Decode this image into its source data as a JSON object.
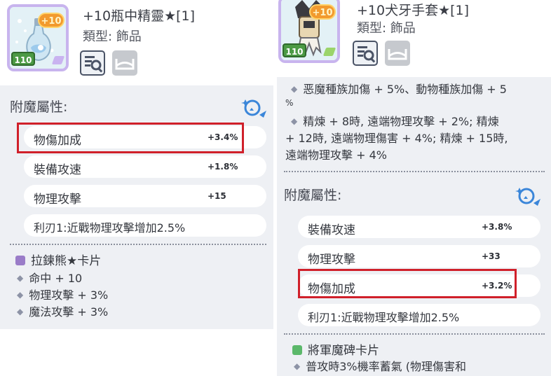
{
  "left_item": {
    "name": "+10瓶中精靈★[1]",
    "type_label": "類型: 飾品",
    "plus_badge": "+10",
    "level_badge": "110",
    "enchant_title": "附魔屬性:",
    "attributes": [
      {
        "name": "物傷加成",
        "value": "+3.4%"
      },
      {
        "name": "裝備攻速",
        "value": "+1.8%"
      },
      {
        "name": "物理攻擊",
        "value": "+15"
      }
    ],
    "special_attribute": "利刃1:近戰物理攻擊增加2.5%",
    "card": {
      "name": "拉鍊熊★卡片",
      "effects": [
        "命中 + 10",
        "物理攻擊 + 3%",
        "魔法攻擊 + 3%"
      ]
    }
  },
  "right_item": {
    "name": "+10犬牙手套★[1]",
    "type_label": "類型: 飾品",
    "plus_badge": "+10",
    "level_badge": "110",
    "refine_effects": [
      "恶魔種族加傷 + 5%、動物種族加傷 + 5",
      "%",
      "精煉 + 8時, 遠端物理攻擊 + 2%; 精煉",
      "+ 12時, 遠端物理傷害 + 4%; 精煉 + 15時,",
      "遠端物理攻擊 + 4%"
    ],
    "enchant_title": "附魔屬性:",
    "attributes": [
      {
        "name": "裝備攻速",
        "value": "+3.8%"
      },
      {
        "name": "物理攻擊",
        "value": "+33"
      },
      {
        "name": "物傷加成",
        "value": "+3.2%"
      }
    ],
    "special_attribute": "利刃1:近戰物理攻擊增加2.5%",
    "card": {
      "name": "將軍魔碑卡片",
      "effects": [
        "普攻時3%機率蓄氣 (物理傷害和"
      ]
    }
  },
  "colors": {
    "highlight": "#d0202a",
    "panel_background": "#eef0f4",
    "frame_border": "#c8b4ee",
    "plus_badge": "#f29a2e",
    "level_badge": "#4c9a45",
    "left_card_badge": "#9a7cc8",
    "right_card_badge": "#5bb86a"
  },
  "icons": {
    "inspect": "magnifier-icon",
    "disabled": "empty-tray-icon",
    "enchant": "enchant-magnifier-icon",
    "bullet": "diamond-bullet-icon"
  }
}
